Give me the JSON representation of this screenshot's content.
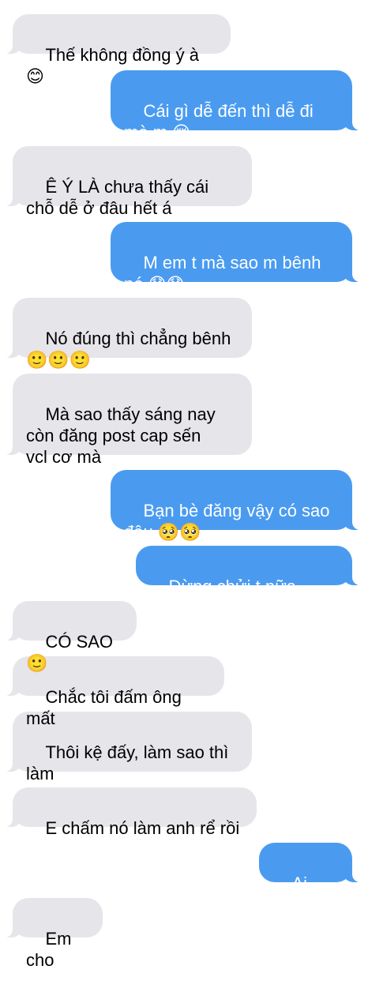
{
  "conversation": {
    "messages": [
      {
        "sender": "them",
        "text": "Thế không đồng ý à 😊"
      },
      {
        "sender": "me",
        "text": "Cái gì dễ đến thì dễ đi\nmà m 😔"
      },
      {
        "sender": "them",
        "text": "Ê Ý LÀ chưa thấy cái\nchỗ dễ ở đâu hết á"
      },
      {
        "sender": "me",
        "text": "M em t mà sao m bênh\nnó 😞😞"
      },
      {
        "sender": "them",
        "text": "Nó đúng thì chẳng bênh\n🙂🙂🙂"
      },
      {
        "sender": "them",
        "text": "Mà sao thấy sáng nay\ncòn đăng post cap sến\nvcl cơ mà"
      },
      {
        "sender": "me",
        "text": "Bạn bè đăng vậy có sao\nđâu 🥺🥺"
      },
      {
        "sender": "me",
        "text": "Đừng chửi t nữa huhu"
      },
      {
        "sender": "them",
        "text": "CÓ SAO 🙂"
      },
      {
        "sender": "them",
        "text": "Chắc tôi đấm ông mất"
      },
      {
        "sender": "them",
        "text": "Thôi kệ đấy, làm sao thì\nlàm"
      },
      {
        "sender": "them",
        "text": "E chấm nó làm anh rể rồi"
      },
      {
        "sender": "me",
        "text": "Ai cho?"
      },
      {
        "sender": "them",
        "text": "Em cho"
      }
    ]
  },
  "colors": {
    "incoming_bubble": "#e5e5ea",
    "outgoing_bubble": "#4a9bf0",
    "outgoing_text": "#ffffff",
    "incoming_text": "#000000"
  }
}
